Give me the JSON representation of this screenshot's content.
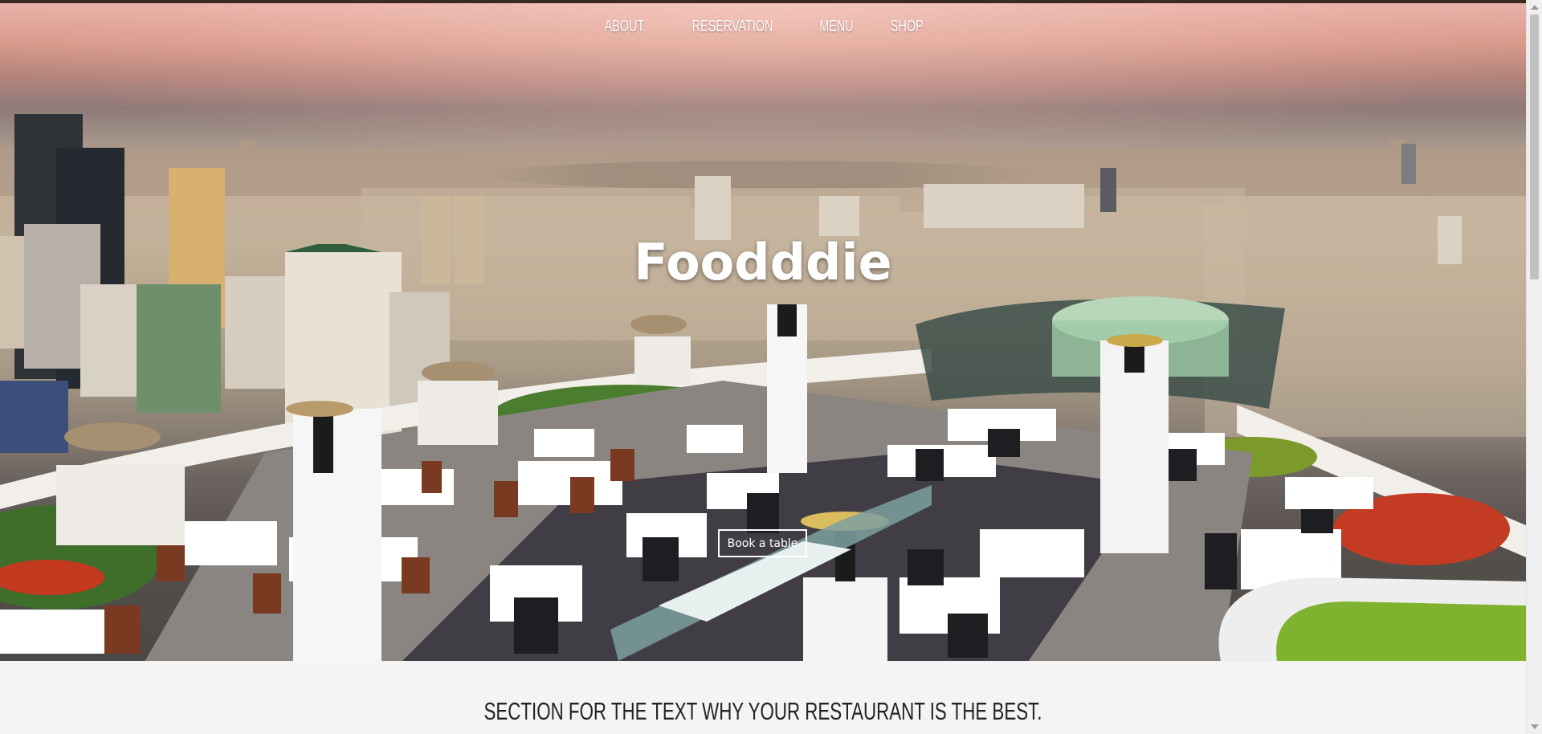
{
  "nav": {
    "items": [
      {
        "label": "ABOUT"
      },
      {
        "label": "RESERVATION"
      },
      {
        "label": "MENU"
      },
      {
        "label": "SHOP"
      }
    ]
  },
  "hero": {
    "title": "Foodddie",
    "cta_label": "Book a table",
    "image_subject": "rooftop restaurant terrace overlooking a city skyline at dusk"
  },
  "section": {
    "heading": "SECTION FOR THE TEXT WHY YOUR RESTAURANT IS THE BEST."
  },
  "colors": {
    "top_strip": "#3b2a22",
    "text_light": "#ffffff",
    "text_dark": "#222222",
    "page_background": "#f4f4f4"
  }
}
